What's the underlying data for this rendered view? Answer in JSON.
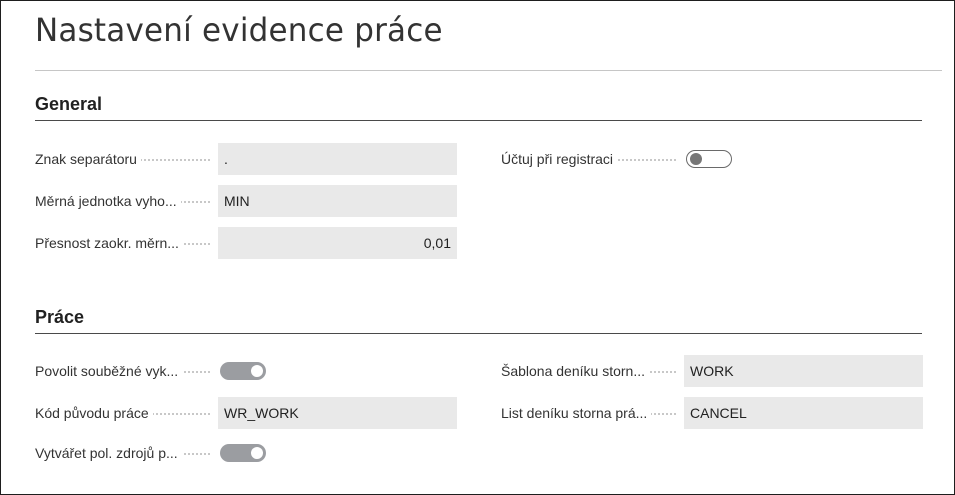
{
  "page": {
    "title": "Nastavení evidence práce"
  },
  "general": {
    "heading": "General",
    "separator_label": "Znak separátoru",
    "separator_value": ".",
    "unit_label": "Měrná jednotka vyho...",
    "unit_value": "MIN",
    "rounding_label": "Přesnost zaokr. měrn...",
    "rounding_value": "0,01",
    "post_on_register_label": "Účtuj při registraci",
    "post_on_register_on": false
  },
  "work": {
    "heading": "Práce",
    "allow_concurrent_label": "Povolit souběžné vyk...",
    "allow_concurrent_on": true,
    "source_code_label": "Kód původu práce",
    "source_code_value": "WR_WORK",
    "create_resource_label": "Vytvářet pol. zdrojů p...",
    "create_resource_on": true,
    "reversal_template_label": "Šablona deníku storn...",
    "reversal_template_value": "WORK",
    "reversal_batch_label": "List deníku storna prá...",
    "reversal_batch_value": "CANCEL"
  }
}
